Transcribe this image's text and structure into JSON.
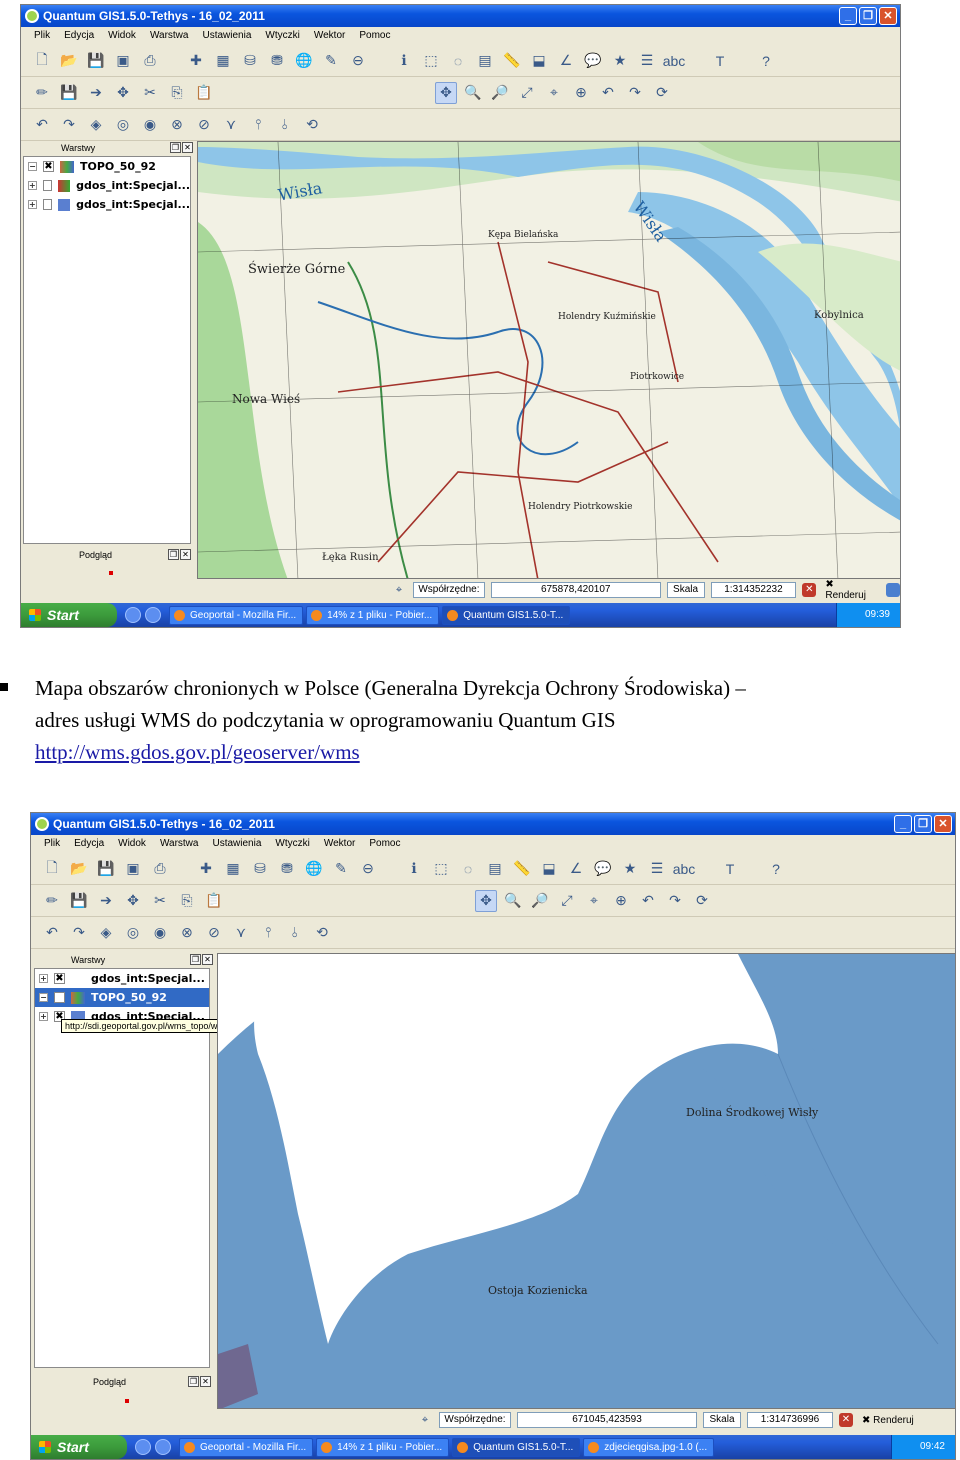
{
  "screenshot1": {
    "window_title": "Quantum GIS1.5.0-Tethys - 16_02_2011",
    "menu": [
      "Plik",
      "Edycja",
      "Widok",
      "Warstwa",
      "Ustawienia",
      "Wtyczki",
      "Wektor",
      "Pomoc"
    ],
    "legend_title": "Warstwy",
    "layers": [
      {
        "name": "TOPO_50_92",
        "checked": "✖"
      },
      {
        "name": "gdos_int:Specjal...",
        "checked": ""
      },
      {
        "name": "gdos_int:Specjal...",
        "checked": ""
      }
    ],
    "preview_title": "Podgląd",
    "status": {
      "coord_label": "Współrzędne:",
      "coords": "675878,420107",
      "scale_label": "Skala",
      "scale": "1:314352232",
      "render_label": "Renderuj"
    },
    "taskbar": {
      "start": "Start",
      "tasks": [
        "Geoportal - Mozilla Fir...",
        "14% z 1 pliku - Pobier...",
        "Quantum GIS1.5.0-T..."
      ],
      "time": "09:39"
    },
    "map_labels": [
      "Wisła",
      "Świerże Górne",
      "Nowa Wieś",
      "Kępa Bielańska",
      "Kobylnica",
      "Piotrkowice",
      "Holendry Kuźmińskie",
      "Holendry Piotrkowskie",
      "Łęka Rusin"
    ]
  },
  "caption": {
    "line1": "Mapa obszarów chronionych w Polsce (Generalna Dyrekcja Ochrony Środowiska) –",
    "line2": "adres usługi WMS do podczytania w oprogramowaniu Quantum GIS",
    "link": "http://wms.gdos.gov.pl/geoserver/wms"
  },
  "screenshot2": {
    "window_title": "Quantum GIS1.5.0-Tethys - 16_02_2011",
    "menu": [
      "Plik",
      "Edycja",
      "Widok",
      "Warstwa",
      "Ustawienia",
      "Wtyczki",
      "Wektor",
      "Pomoc"
    ],
    "legend_title": "Warstwy",
    "layers": [
      {
        "name": "gdos_int:Specjal...",
        "checked": "✖"
      },
      {
        "name": "TOPO_50_92",
        "checked": ""
      },
      {
        "name": "gdos_int:Specjal...",
        "checked": "✖"
      }
    ],
    "tooltip": "http://sdi.geoportal.gov.pl/wms_topo/wmservice.aspx",
    "preview_title": "Podgląd",
    "map_labels": [
      "Dolina Środkowej Wisły",
      "Ostoja Kozienicka"
    ],
    "status": {
      "coord_label": "Współrzędne:",
      "coords": "671045,423593",
      "scale_label": "Skala",
      "scale": "1:314736996",
      "render_label": "Renderuj"
    },
    "taskbar": {
      "start": "Start",
      "tasks": [
        "Geoportal - Mozilla Fir...",
        "14% z 1 pliku - Pobier...",
        "Quantum GIS1.5.0-T...",
        "zdjecieqgisa.jpg-1.0 (..."
      ],
      "time": "09:42"
    }
  },
  "colors": {
    "titlebar": "#0a55de",
    "taskbar": "#245edb",
    "protected_area": "#6a9ac8",
    "river": "#8ec5e8",
    "forest": "#a9d89a"
  }
}
